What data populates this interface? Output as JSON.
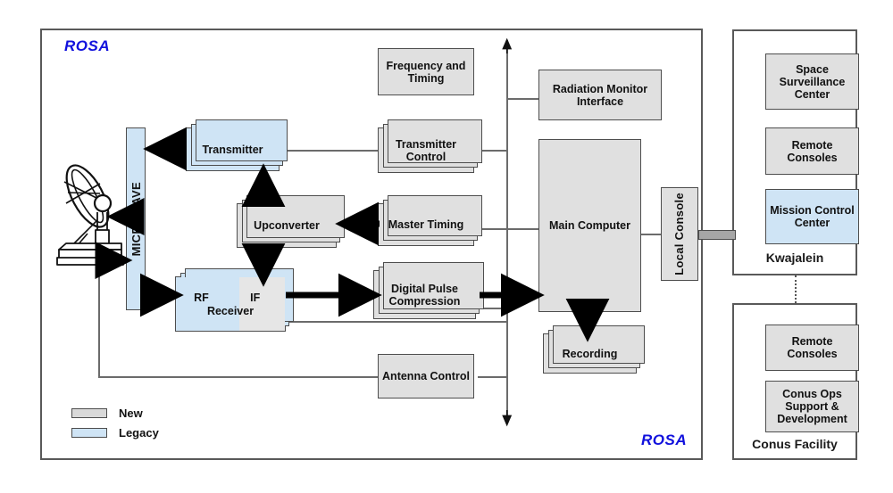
{
  "diagram": {
    "rosa_label_top": "ROSA",
    "rosa_label_bottom": "ROSA",
    "microwave_label": "MICROWAVE",
    "local_console_label": "Local Console",
    "antenna_icon": "satellite-dish-antenna"
  },
  "legend": {
    "items": [
      {
        "label": "New",
        "color": "#d9d9d9",
        "type": "new"
      },
      {
        "label": "Legacy",
        "color": "#cfe4f5",
        "type": "legacy"
      }
    ]
  },
  "rosa_boxes": {
    "transmitter": "Transmitter",
    "frequency_and_timing": "Frequency and Timing",
    "transmitter_control": "Transmitter Control",
    "radiation_monitor_interface": "Radiation Monitor Interface",
    "upconverter": "Upconverter",
    "master_timing": "Master Timing",
    "main_computer": "Main Computer",
    "rf_receiver_rf": "RF",
    "rf_receiver_if": "IF",
    "rf_receiver_name": "Receiver",
    "digital_pulse_compression": "Digital Pulse Compression",
    "recording": "Recording",
    "antenna_control": "Antenna Control"
  },
  "kwajalein": {
    "title": "Kwajalein",
    "boxes": [
      {
        "label": "Space Surveillance Center",
        "type": "new"
      },
      {
        "label": "Remote Consoles",
        "type": "new"
      },
      {
        "label": "Mission Control Center",
        "type": "legacy"
      }
    ]
  },
  "conus": {
    "title": "Conus Facility",
    "boxes": [
      {
        "label": "Remote Consoles",
        "type": "new"
      },
      {
        "label": "Conus Ops Support & Development",
        "type": "new"
      }
    ]
  },
  "colors": {
    "new": "#e0e0e0",
    "legacy": "#cfe4f5",
    "border": "#4d4d4d",
    "rosa_text": "#1111dd",
    "line": "#6b6b6b"
  }
}
